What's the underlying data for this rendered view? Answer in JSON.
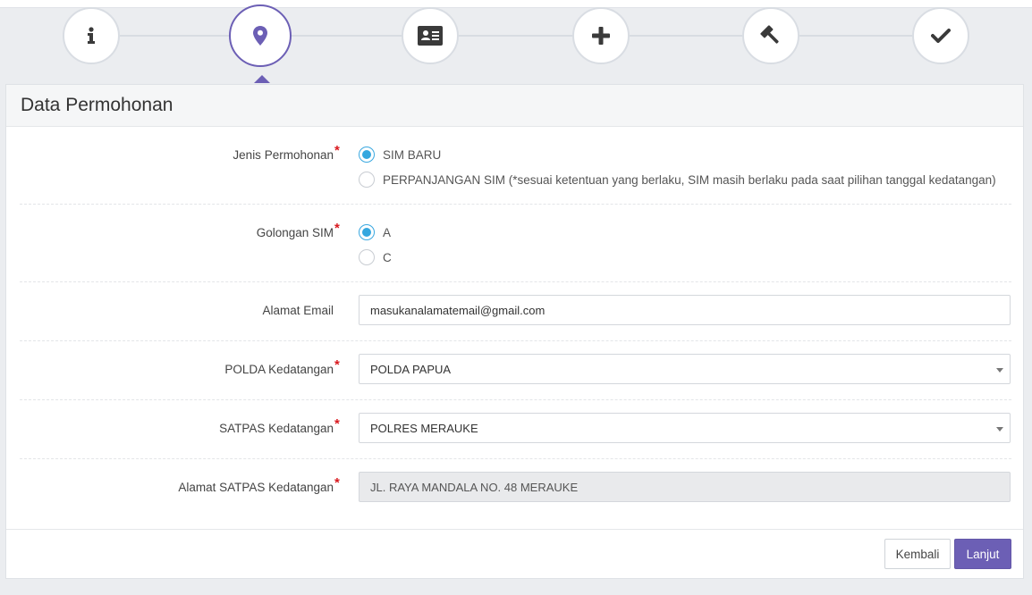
{
  "wizard": {
    "steps": [
      {
        "icon": "info-icon",
        "active": false
      },
      {
        "icon": "map-marker-icon",
        "active": true
      },
      {
        "icon": "id-card-icon",
        "active": false
      },
      {
        "icon": "plus-icon",
        "active": false
      },
      {
        "icon": "gavel-icon",
        "active": false
      },
      {
        "icon": "check-icon",
        "active": false
      }
    ],
    "accent_color": "#6c5fb5"
  },
  "panel": {
    "title": "Data Permohonan"
  },
  "form": {
    "jenis_permohonan": {
      "label": "Jenis Permohonan",
      "required_mark": "*",
      "options": [
        {
          "label": "SIM BARU",
          "checked": true
        },
        {
          "label": "PERPANJANGAN SIM (*sesuai ketentuan yang berlaku, SIM masih berlaku pada saat pilihan tanggal kedatangan)",
          "checked": false
        }
      ]
    },
    "golongan_sim": {
      "label": "Golongan SIM",
      "required_mark": "*",
      "options": [
        {
          "label": "A",
          "checked": true
        },
        {
          "label": "C",
          "checked": false
        }
      ]
    },
    "alamat_email": {
      "label": "Alamat Email",
      "value": "masukanalamatemail@gmail.com"
    },
    "polda_kedatangan": {
      "label": "POLDA Kedatangan",
      "required_mark": "*",
      "selected": "POLDA PAPUA"
    },
    "satpas_kedatangan": {
      "label": "SATPAS Kedatangan",
      "required_mark": "*",
      "selected": "POLRES MERAUKE"
    },
    "alamat_satpas": {
      "label": "Alamat SATPAS Kedatangan",
      "required_mark": "*",
      "value": "JL. RAYA MANDALA NO. 48 MERAUKE"
    }
  },
  "actions": {
    "back_label": "Kembali",
    "next_label": "Lanjut"
  },
  "colors": {
    "radio_checked": "#34a7df",
    "required": "#d9181e",
    "primary_button": "#6c5fb5"
  }
}
